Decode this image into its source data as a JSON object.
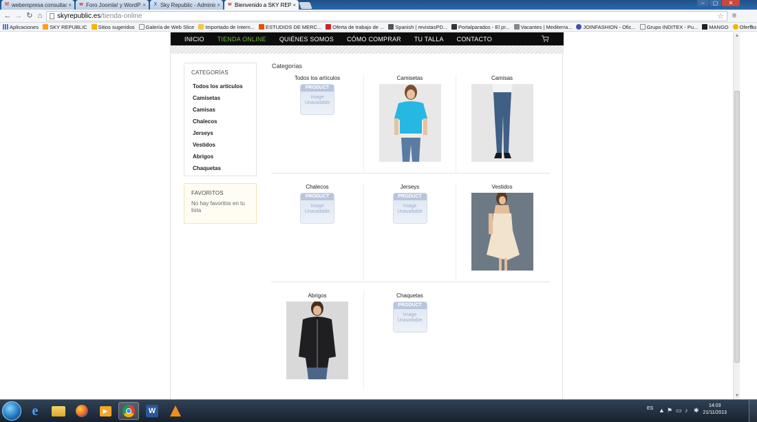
{
  "browser": {
    "tabs": [
      {
        "title": "webempresa consultas - s",
        "favicon_color": "#d14836",
        "favicon_glyph": "M"
      },
      {
        "title": "Foro Joomla! y WordPres",
        "favicon_color": "#c62828",
        "favicon_glyph": "w"
      },
      {
        "title": "Sky Republic - Administra",
        "favicon_color": "#3f6fb5",
        "favicon_glyph": "X"
      },
      {
        "title": "Bienvenido a SKY REPUBL",
        "favicon_color": "#c62828",
        "favicon_glyph": "w",
        "active": true
      }
    ],
    "url_host": "skyrepublic.es",
    "url_path": "/tienda-online",
    "bookmarks": [
      {
        "label": "Aplicaciones",
        "color": "#4a7bd0"
      },
      {
        "label": "SKY REPUBLIC",
        "color": "#ff9f1c"
      },
      {
        "label": "Sitios sugeridos",
        "color": "#f4b400"
      },
      {
        "label": "Galería de Web Slice",
        "color": "#ffffff"
      },
      {
        "label": "Importado de Intern...",
        "color": "#f2c84b"
      },
      {
        "label": "ESTUDIOS DE MERC...",
        "color": "#e65100"
      },
      {
        "label": "Oferta de trabajo de ...",
        "color": "#c62828"
      },
      {
        "label": "Spanish | revistasPD...",
        "color": "#555555"
      },
      {
        "label": "Portalparados - El pr...",
        "color": "#333333"
      },
      {
        "label": "Vacantes | Mediterra...",
        "color": "#888888"
      },
      {
        "label": "JOINFASHION - Ofic...",
        "color": "#3f51b5"
      },
      {
        "label": "Grupo INDITEX - Pu...",
        "color": "#ffffff"
      },
      {
        "label": "MANGO",
        "color": "#222222"
      },
      {
        "label": "Ofertas - Trabaja co...",
        "color": "#f4b400"
      }
    ],
    "bookmarks_more": "»"
  },
  "site": {
    "nav": [
      "INICIO",
      "TIENDA ONLINE",
      "QUIÉNES SOMOS",
      "CÓMO COMPRAR",
      "TU TALLA",
      "CONTACTO"
    ],
    "nav_active_index": 1,
    "accent_color": "#6fbf3a",
    "sidebar": {
      "categories_title": "CATEGORÍAS",
      "categories": [
        "Todos los artículos",
        "Camisetas",
        "Camisas",
        "Chalecos",
        "Jerseys",
        "Vestidos",
        "Abrigos",
        "Chaquetas"
      ],
      "favorites_title": "FAVORITOS",
      "favorites_text": "No hay favoritos en tu lista"
    },
    "main": {
      "title": "Categorías",
      "placeholder_top": "PRODUCT",
      "placeholder_line1": "Image",
      "placeholder_line2": "Unavailable",
      "items": [
        {
          "label": "Todos los artículos",
          "image": "placeholder"
        },
        {
          "label": "Camisetas",
          "image": "photo-tshirt"
        },
        {
          "label": "Camisas",
          "image": "photo-jeans"
        },
        {
          "label": "Chalecos",
          "image": "placeholder"
        },
        {
          "label": "Jerseys",
          "image": "placeholder"
        },
        {
          "label": "Vestidos",
          "image": "photo-dress"
        },
        {
          "label": "Abrigos",
          "image": "photo-jacket"
        },
        {
          "label": "Chaquetas",
          "image": "placeholder"
        }
      ]
    }
  },
  "taskbar": {
    "language": "ES",
    "time": "14:03",
    "date": "21/11/2013"
  }
}
